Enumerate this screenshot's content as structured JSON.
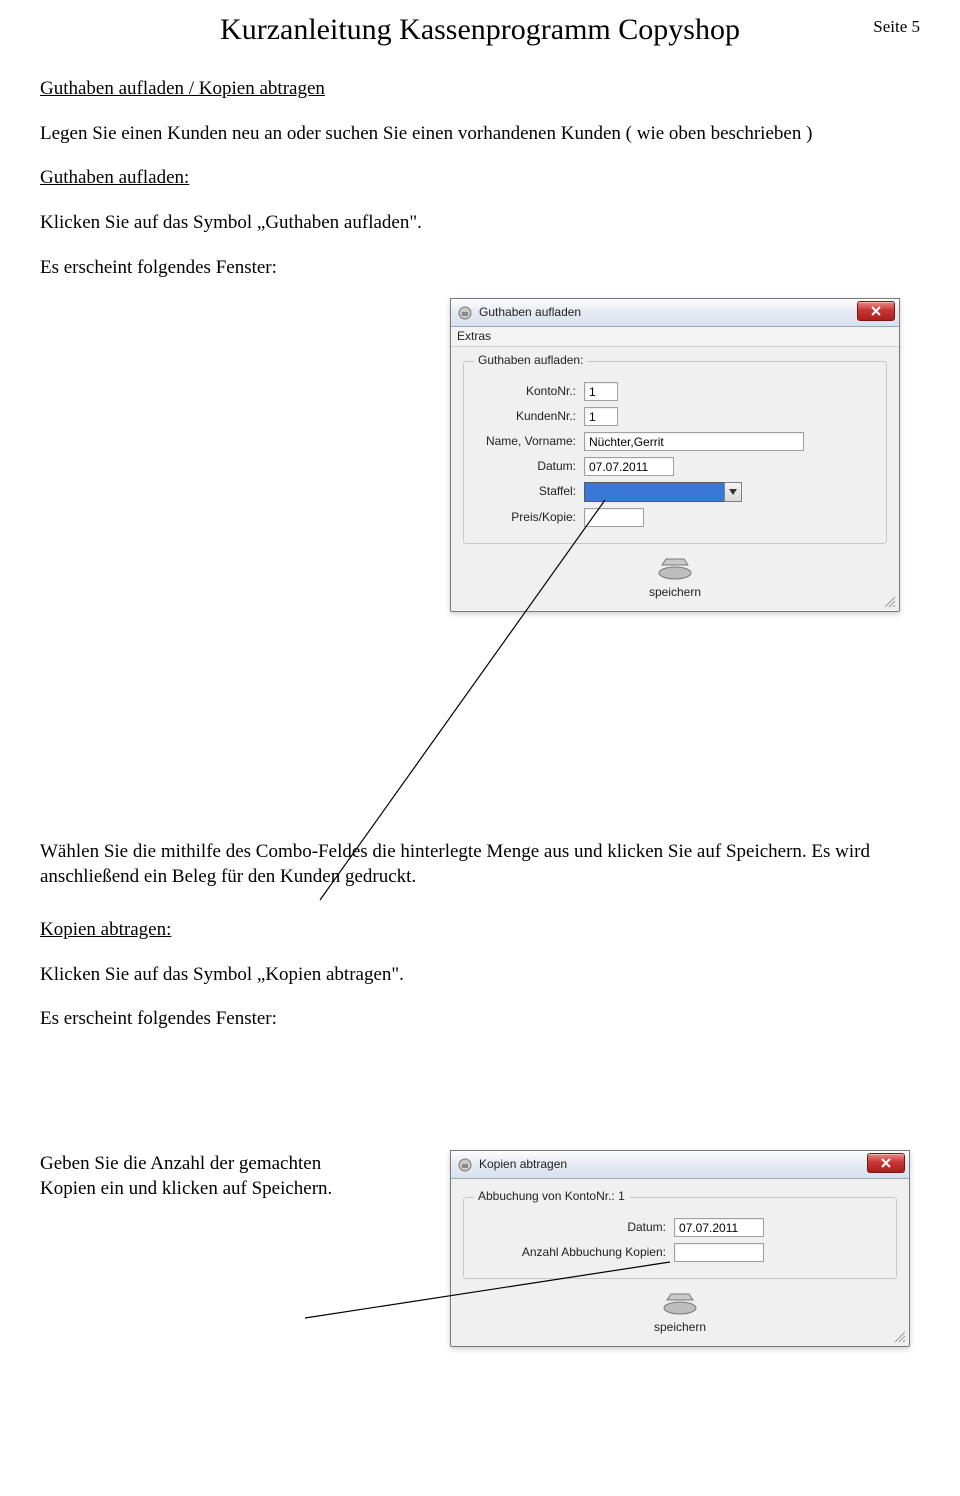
{
  "header": {
    "title": "Kurzanleitung Kassenprogramm Copyshop",
    "page_label": "Seite 5"
  },
  "body": {
    "heading1": "Guthaben aufladen / Kopien abtragen",
    "para1": "Legen Sie einen Kunden neu an oder suchen Sie einen vorhandenen Kunden ( wie oben beschrieben )",
    "heading2": "Guthaben aufladen:",
    "para2": "Klicken Sie auf das Symbol „Guthaben aufladen\".",
    "para3": "Es erscheint folgendes Fenster:",
    "para4": "Wählen Sie die mithilfe des Combo-Feldes die hinterlegte Menge aus und klicken Sie auf Speichern. Es wird anschließend ein Beleg für den Kunden gedruckt.",
    "heading3": "Kopien abtragen:",
    "para5": "Klicken Sie auf das Symbol „Kopien abtragen\".",
    "para6": "Es erscheint folgendes Fenster:",
    "para7a": "Geben Sie die Anzahl der gemachten",
    "para7b": "Kopien ein und klicken auf Speichern."
  },
  "dialog1": {
    "title": "Guthaben aufladen",
    "menu_extras": "Extras",
    "group_title": "Guthaben aufladen:",
    "konto_label": "KontoNr.:",
    "konto_value": "1",
    "kunden_label": "KundenNr.:",
    "kunden_value": "1",
    "name_label": "Name, Vorname:",
    "name_value": "Nüchter,Gerrit",
    "datum_label": "Datum:",
    "datum_value": "07.07.2011",
    "staffel_label": "Staffel:",
    "staffel_value": "",
    "preis_label": "Preis/Kopie:",
    "preis_value": "",
    "save_label": "speichern"
  },
  "dialog2": {
    "title": "Kopien abtragen",
    "group_title": "Abbuchung von KontoNr.:  1",
    "datum_label": "Datum:",
    "datum_value": "07.07.2011",
    "anzahl_label": "Anzahl Abbuchung Kopien:",
    "anzahl_value": "",
    "save_label": "speichern"
  }
}
